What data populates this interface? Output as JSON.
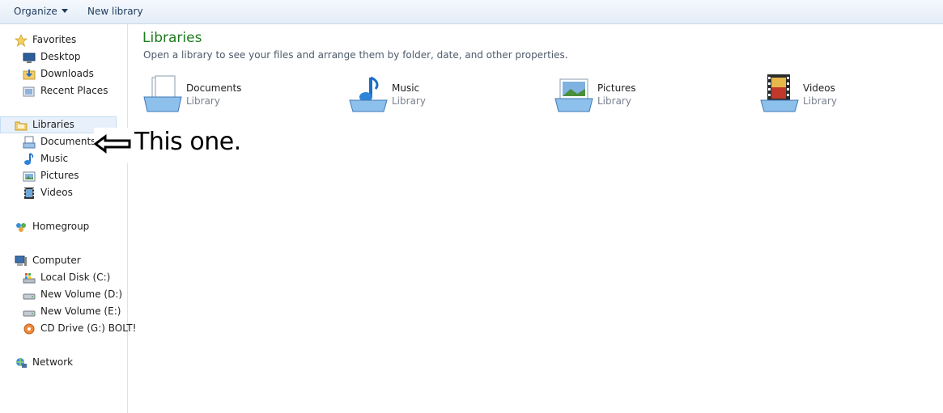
{
  "toolbar": {
    "organize_label": "Organize",
    "new_library_label": "New library"
  },
  "nav": {
    "favorites": {
      "label": "Favorites",
      "items": [
        "Desktop",
        "Downloads",
        "Recent Places"
      ]
    },
    "libraries": {
      "label": "Libraries",
      "items": [
        "Documents",
        "Music",
        "Pictures",
        "Videos"
      ]
    },
    "homegroup": {
      "label": "Homegroup"
    },
    "computer": {
      "label": "Computer",
      "items": [
        "Local Disk (C:)",
        "New Volume (D:)",
        "New Volume (E:)",
        "CD Drive (G:) BOLT!"
      ]
    },
    "network": {
      "label": "Network"
    }
  },
  "main": {
    "title": "Libraries",
    "subtitle": "Open a library to see your files and arrange them by folder, date, and other properties.",
    "libraries": [
      {
        "name": "Documents",
        "kind": "Library"
      },
      {
        "name": "Music",
        "kind": "Library"
      },
      {
        "name": "Pictures",
        "kind": "Library"
      },
      {
        "name": "Videos",
        "kind": "Library"
      }
    ]
  },
  "annotation": {
    "text": "This one."
  }
}
